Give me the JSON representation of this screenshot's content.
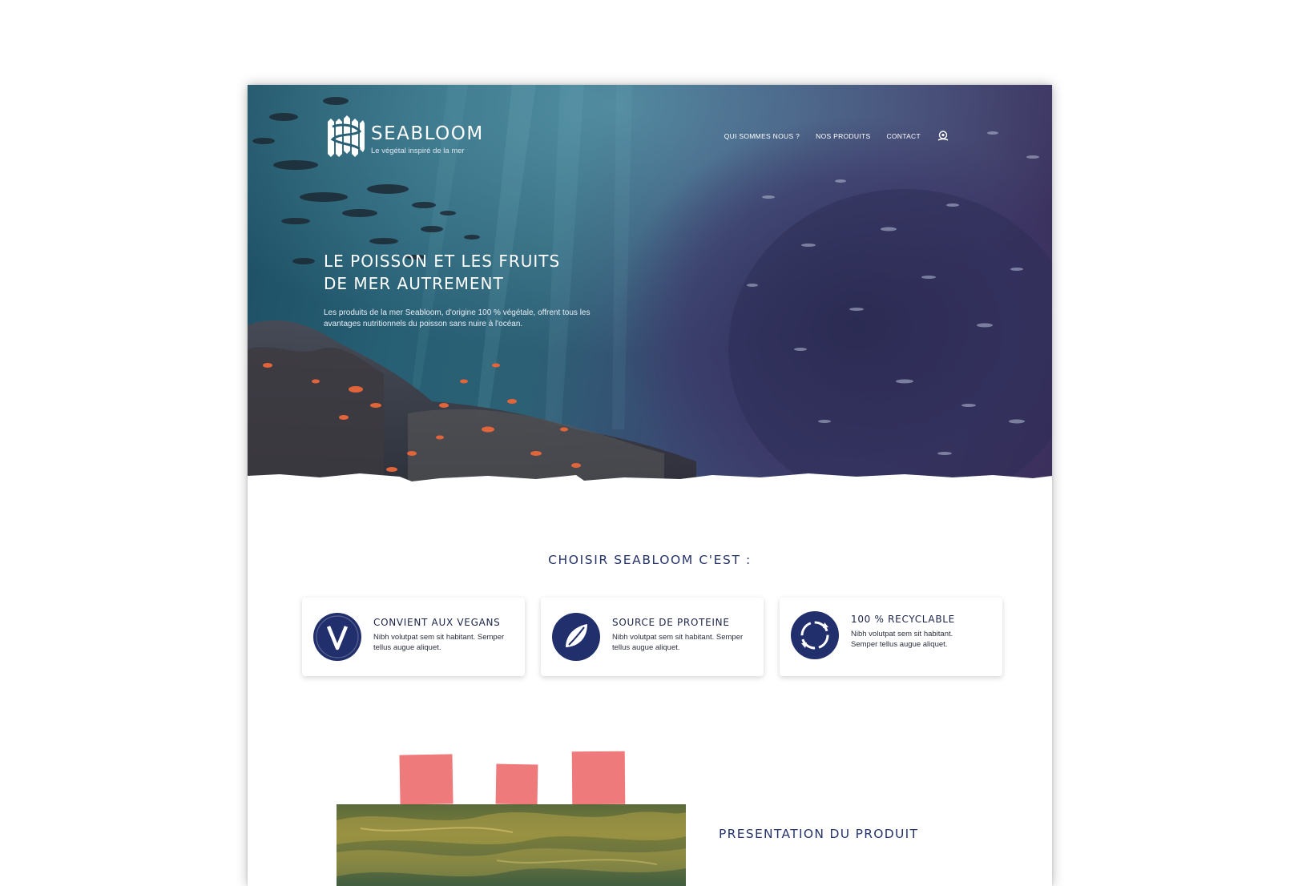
{
  "brand": {
    "name": "SEABLOOM",
    "tagline": "Le végétal inspiré de la mer"
  },
  "nav": {
    "items": [
      {
        "label": "QUI SOMMES NOUS ?"
      },
      {
        "label": "NOS PRODUITS"
      },
      {
        "label": "CONTACT"
      }
    ],
    "account_icon": "user-location-icon"
  },
  "hero": {
    "title_line1": "LE POISSON ET LES FRUITS",
    "title_line2": "DE MER AUTREMENT",
    "description": "Les produits de la mer Seabloom, d'origine 100 % végétale, offrent tous les avantages nutritionnels du poisson sans nuire à l'océan."
  },
  "features": {
    "title": "CHOISIR SEABLOOM C'EST :",
    "cards": [
      {
        "icon": "vegan-v-icon",
        "title": "CONVIENT AUX VEGANS",
        "text": "Nibh volutpat sem sit habitant. Semper tellus augue aliquet."
      },
      {
        "icon": "protein-leaf-icon",
        "title": "SOURCE DE PROTEINE",
        "text": "Nibh volutpat sem sit habitant. Semper tellus augue aliquet."
      },
      {
        "icon": "recycle-icon",
        "title": "100 % RECYCLABLE",
        "text": "Nibh volutpat sem sit habitant. Semper tellus augue aliquet."
      }
    ]
  },
  "product": {
    "title": "PRESENTATION DU PRODUIT"
  },
  "colors": {
    "navy": "#222f6d",
    "coral": "#ef7a7b",
    "heading": "#26346b"
  }
}
